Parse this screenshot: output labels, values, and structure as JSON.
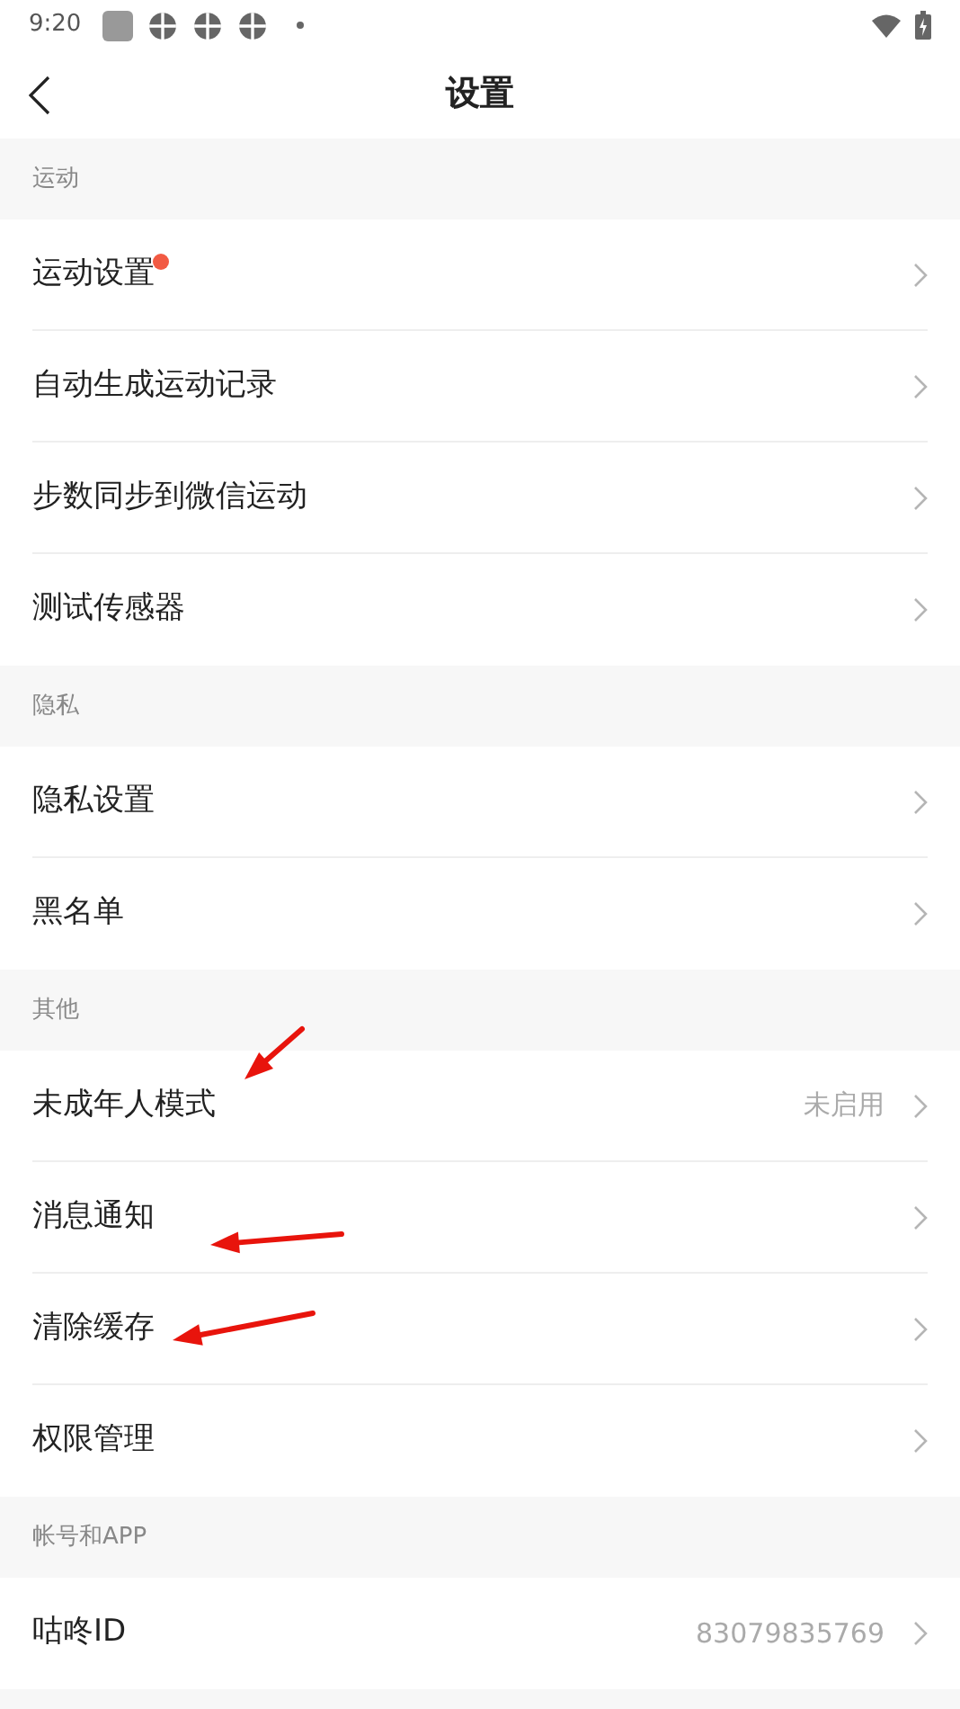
{
  "status_bar": {
    "time": "9:20"
  },
  "header": {
    "title": "设置"
  },
  "sections": [
    {
      "title": "运动",
      "items": [
        {
          "label": "运动设置",
          "badge": true
        },
        {
          "label": "自动生成运动记录",
          "badge": false
        },
        {
          "label": "步数同步到微信运动",
          "badge": false
        },
        {
          "label": "测试传感器",
          "badge": false
        }
      ]
    },
    {
      "title": "隐私",
      "items": [
        {
          "label": "隐私设置",
          "badge": false
        },
        {
          "label": "黑名单",
          "badge": false
        }
      ]
    },
    {
      "title": "其他",
      "items": [
        {
          "label": "未成年人模式",
          "badge": false,
          "value": "未启用"
        },
        {
          "label": "消息通知",
          "badge": false
        },
        {
          "label": "清除缓存",
          "badge": false
        },
        {
          "label": "权限管理",
          "badge": false
        }
      ]
    },
    {
      "title": "帐号和APP",
      "items": [
        {
          "label": "咕咚ID",
          "badge": false,
          "value": "83079835769"
        }
      ]
    }
  ],
  "annotations": [
    {
      "kind": "arrow"
    },
    {
      "kind": "arrow"
    },
    {
      "kind": "arrow"
    }
  ]
}
